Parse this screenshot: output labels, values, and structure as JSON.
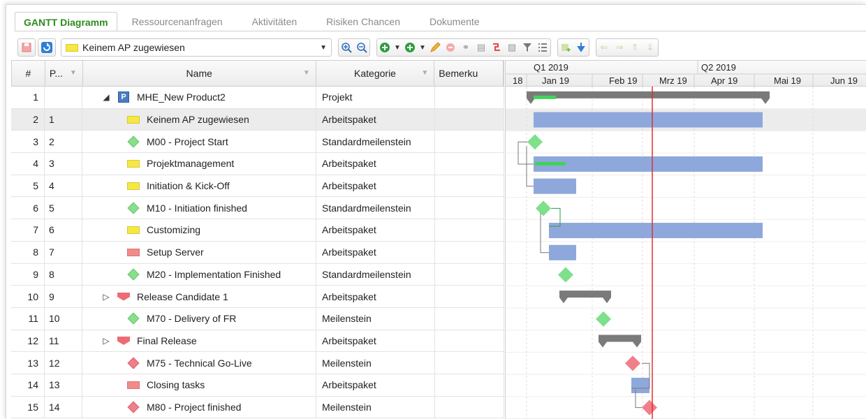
{
  "tabs": [
    "GANTT Diagramm",
    "Ressourcenanfragen",
    "Aktivitäten",
    "Risiken Chancen",
    "Dokumente"
  ],
  "toolbar": {
    "dropdown_value": "Keinem AP zugewiesen"
  },
  "columns": {
    "num": "#",
    "p": "P...",
    "name": "Name",
    "kategorie": "Kategorie",
    "bemerkung": "Bemerku"
  },
  "gantt_header": {
    "quarters": [
      "Q1 2019",
      "Q2 2019"
    ],
    "months": [
      "18",
      "Jan 19",
      "Feb 19",
      "Mrz 19",
      "Apr 19",
      "Mai 19",
      "Jun 19"
    ]
  },
  "rows": [
    {
      "num": "1",
      "p": "",
      "name": "MHE_New Product2",
      "kategorie": "Projekt",
      "icon": "project-icon"
    },
    {
      "num": "2",
      "p": "1",
      "name": "Keinem AP zugewiesen",
      "kategorie": "Arbeitspaket",
      "icon": "work-package-icon"
    },
    {
      "num": "3",
      "p": "2",
      "name": "M00 - Project Start",
      "kategorie": "Standardmeilenstein",
      "icon": "milestone-icon"
    },
    {
      "num": "4",
      "p": "3",
      "name": "Projektmanagement",
      "kategorie": "Arbeitspaket",
      "icon": "work-package-icon"
    },
    {
      "num": "5",
      "p": "4",
      "name": "Initiation & Kick-Off",
      "kategorie": "Arbeitspaket",
      "icon": "work-package-icon"
    },
    {
      "num": "6",
      "p": "5",
      "name": "M10 - Initiation finished",
      "kategorie": "Standardmeilenstein",
      "icon": "milestone-icon"
    },
    {
      "num": "7",
      "p": "6",
      "name": "Customizing",
      "kategorie": "Arbeitspaket",
      "icon": "work-package-icon"
    },
    {
      "num": "8",
      "p": "7",
      "name": "Setup Server",
      "kategorie": "Arbeitspaket",
      "icon": "work-package-red-icon"
    },
    {
      "num": "9",
      "p": "8",
      "name": "M20 - Implementation Finished",
      "kategorie": "Standardmeilenstein",
      "icon": "milestone-icon"
    },
    {
      "num": "10",
      "p": "9",
      "name": "Release Candidate 1",
      "kategorie": "Arbeitspaket",
      "icon": "summary-red-icon"
    },
    {
      "num": "11",
      "p": "10",
      "name": "M70 - Delivery of FR",
      "kategorie": "Meilenstein",
      "icon": "milestone-icon"
    },
    {
      "num": "12",
      "p": "11",
      "name": "Final Release",
      "kategorie": "Arbeitspaket",
      "icon": "summary-red-icon"
    },
    {
      "num": "13",
      "p": "12",
      "name": "M75 - Technical Go-Live",
      "kategorie": "Meilenstein",
      "icon": "milestone-red-icon"
    },
    {
      "num": "14",
      "p": "13",
      "name": "Closing tasks",
      "kategorie": "Arbeitspaket",
      "icon": "work-package-red-icon"
    },
    {
      "num": "15",
      "p": "14",
      "name": "M80 - Project finished",
      "kategorie": "Meilenstein",
      "icon": "milestone-red-icon"
    }
  ],
  "colors": {
    "accent_green": "#2e8b1f",
    "bar_blue": "#8ea8dc",
    "summary_gray": "#7a7a7a",
    "today_line": "#e03030"
  }
}
